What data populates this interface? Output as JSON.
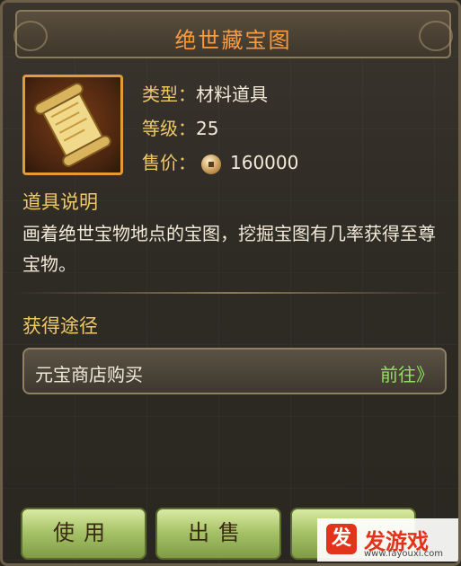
{
  "title": "绝世藏宝图",
  "item": {
    "icon": "treasure-map-scroll-icon",
    "type_label": "类型：",
    "type_value": "材料道具",
    "level_label": "等级：",
    "level_value": "25",
    "price_label": "售价：",
    "price_icon": "coin-icon",
    "price_value": "160000"
  },
  "description": {
    "heading": "道具说明",
    "text": "画着绝世宝物地点的宝图，挖掘宝图有几率获得至尊宝物。"
  },
  "source": {
    "heading": "获得途径",
    "items": [
      {
        "name": "元宝商店购买",
        "action": "前往》"
      }
    ]
  },
  "buttons": {
    "use": "使用",
    "sell": "出售"
  },
  "watermark": {
    "symbol": "发",
    "name": "发游戏",
    "url": "www.fayouxi.com"
  },
  "colors": {
    "title": "#ff9a3c",
    "label": "#f0c86a",
    "go_link": "#8ee35b",
    "button": "#a8c46a"
  }
}
